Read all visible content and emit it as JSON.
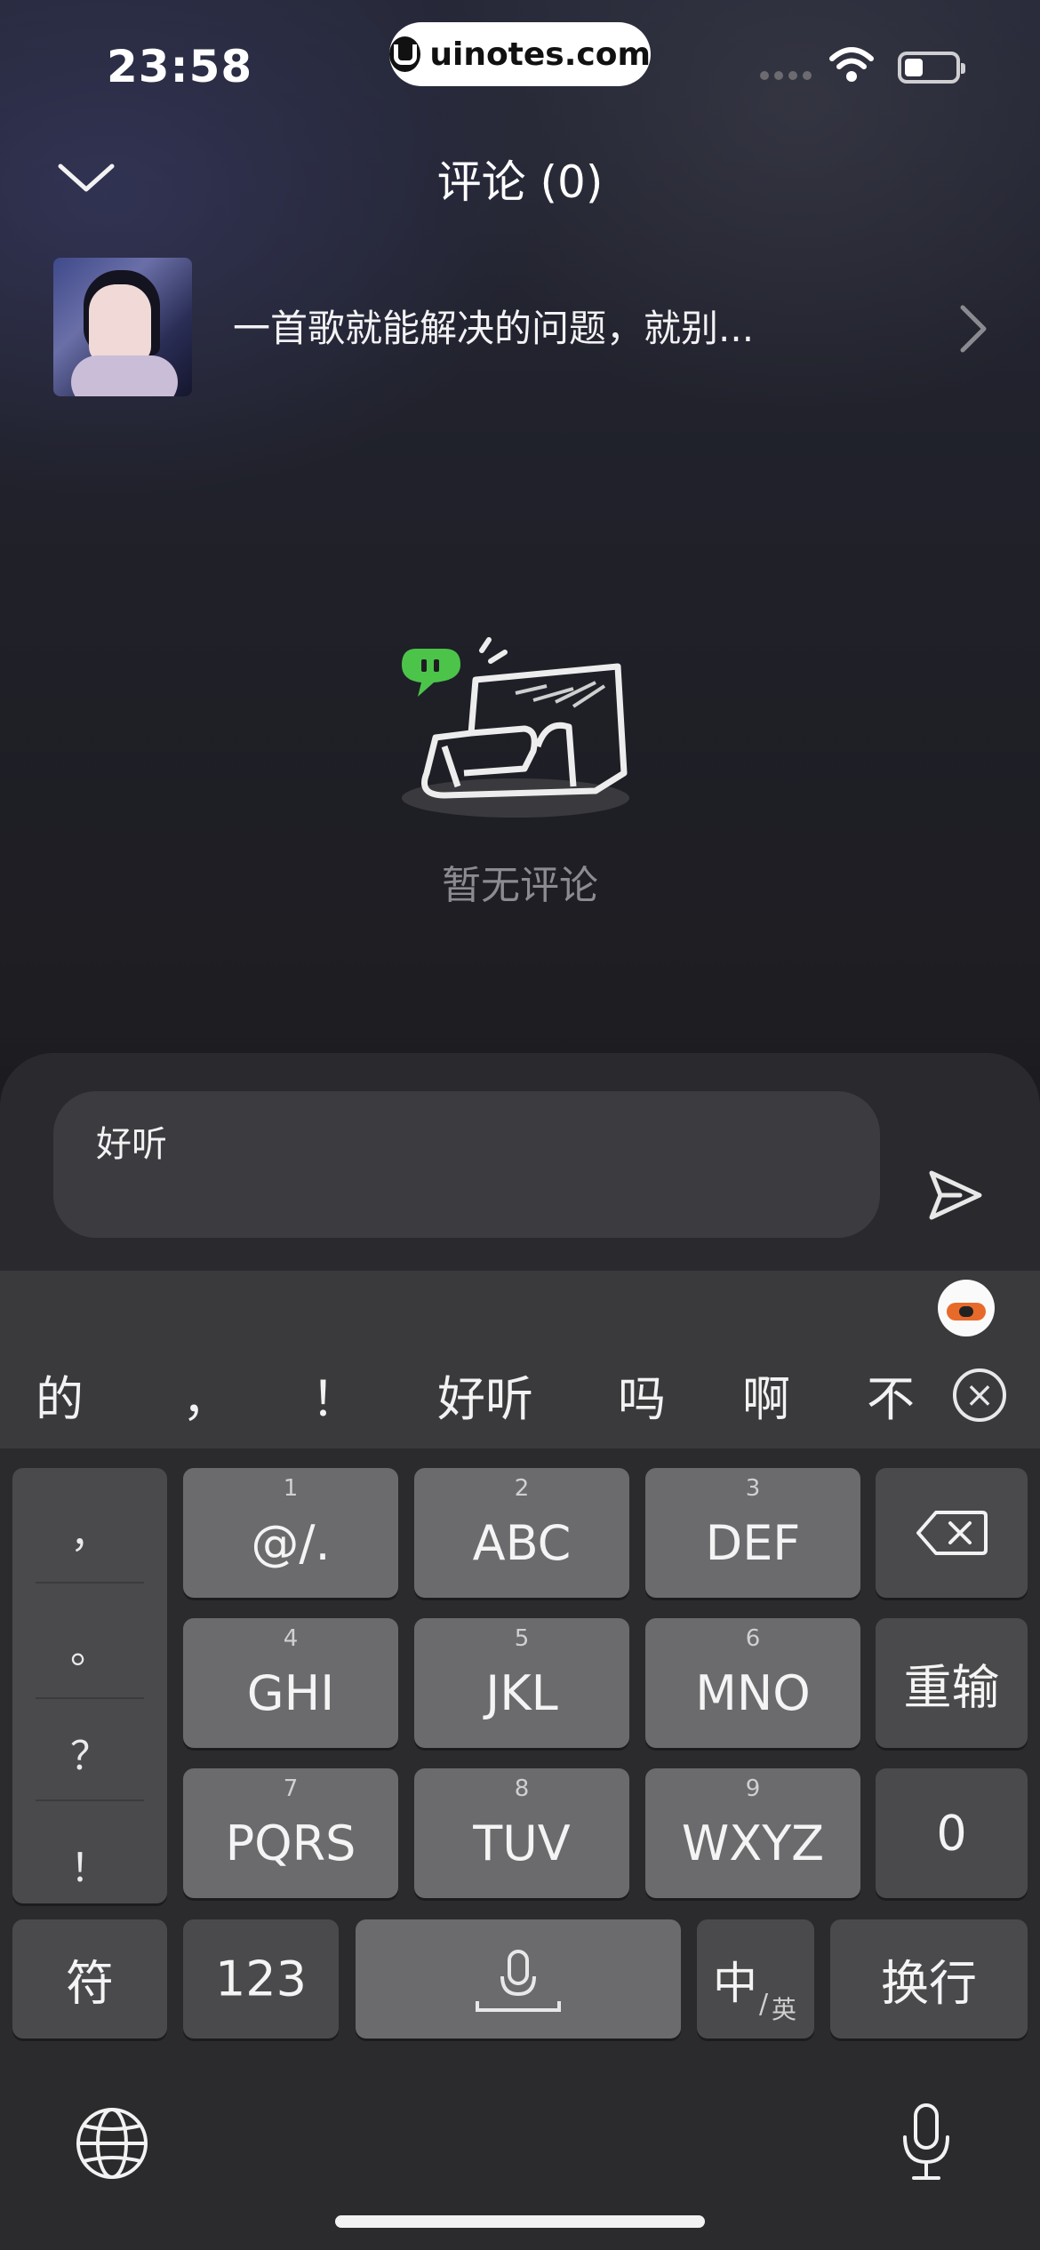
{
  "status_bar": {
    "time": "23:58",
    "watermark": "uinotes.com"
  },
  "header": {
    "title": "评论 (0)"
  },
  "song": {
    "title": "一首歌就能解决的问题，就别..."
  },
  "empty_state": {
    "text": "暂无评论"
  },
  "comment_input": {
    "value": "好听"
  },
  "keyboard": {
    "candidates": [
      "的",
      "，",
      "！",
      "好听",
      "吗",
      "啊",
      "不"
    ],
    "punctuation": [
      "，",
      "。",
      "？",
      "！"
    ],
    "keys": {
      "k1": {
        "num": "1",
        "label": "@/."
      },
      "k2": {
        "num": "2",
        "label": "ABC"
      },
      "k3": {
        "num": "3",
        "label": "DEF"
      },
      "k4": {
        "num": "4",
        "label": "GHI"
      },
      "k5": {
        "num": "5",
        "label": "JKL"
      },
      "k6": {
        "num": "6",
        "label": "MNO"
      },
      "k7": {
        "num": "7",
        "label": "PQRS"
      },
      "k8": {
        "num": "8",
        "label": "TUV"
      },
      "k9": {
        "num": "9",
        "label": "WXYZ"
      },
      "reset": "重输",
      "zero": "0",
      "symbols": "符",
      "numbers": "123",
      "zh": "中",
      "en": "英",
      "newline": "换行"
    }
  },
  "icons": {
    "collapse": "chevron-down-icon",
    "song_arrow": "chevron-right-icon",
    "send": "send-icon",
    "delete": "backspace-icon",
    "globe": "globe-icon",
    "mic": "microphone-icon",
    "space_mic": "microphone-icon"
  },
  "colors": {
    "accent_green": "#4cc44a"
  }
}
